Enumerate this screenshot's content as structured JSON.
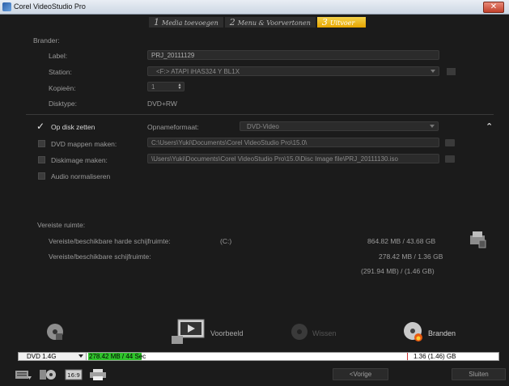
{
  "window": {
    "title": "Corel VideoStudio Pro",
    "close_glyph": "✕"
  },
  "steps": [
    {
      "num": "1",
      "label": "Media toevoegen",
      "active": false
    },
    {
      "num": "2",
      "label": "Menu & Voorvertonen",
      "active": false
    },
    {
      "num": "3",
      "label": "Uitvoer",
      "active": true
    }
  ],
  "burner": {
    "section": "Brander:",
    "label_caption": "Label:",
    "label_value": "PRJ_20111129",
    "station_caption": "Station:",
    "station_value": "<F:> ATAPI iHAS324 Y BL1X",
    "copies_caption": "Kopieën:",
    "copies_value": "1",
    "disktype_caption": "Disktype:",
    "disktype_value": "DVD+RW"
  },
  "options": {
    "burn_to_disc": {
      "label": "Op disk zetten",
      "checked": true
    },
    "record_format_caption": "Opnameformaat:",
    "record_format_value": "DVD-Video",
    "collapse_glyph": "⌃",
    "dvd_folders": {
      "label": "DVD mappen maken:",
      "checked": false,
      "path": "C:\\Users\\Yuki\\Documents\\Corel VideoStudio Pro\\15.0\\"
    },
    "disc_image": {
      "label": "Diskimage maken:",
      "checked": false,
      "path": "\\Users\\Yuki\\Documents\\Corel VideoStudio Pro\\15.0\\Disc Image file\\PRJ_20111130.iso"
    },
    "normalize_audio": {
      "label": "Audio normaliseren",
      "checked": false
    }
  },
  "space": {
    "section": "Vereiste ruimte:",
    "hd_caption": "Vereiste/beschikbare harde schijfruimte:",
    "hd_drive": "(C:)",
    "hd_value": "864.82 MB  /  43.68 GB",
    "disc_caption": "Vereiste/beschikbare schijfruimte:",
    "disc_value": "278.42 MB  /  1.36 GB",
    "disc_value2": "(291.94 MB)  /  (1.46 GB)"
  },
  "actions": {
    "preview": "Voorbeeld",
    "erase": "Wissen",
    "burn": "Branden"
  },
  "capacity": {
    "disc_option": "DVD 1.4G",
    "used_text": "278.42 MB / 44 Sec",
    "total_text": "1.36 (1.46) GB",
    "used_fraction": 0.13
  },
  "nav": {
    "prev": "<Vorige",
    "close": "Sluiten"
  },
  "colors": {
    "accent": "#e6a400",
    "fill": "#2fc42b"
  }
}
